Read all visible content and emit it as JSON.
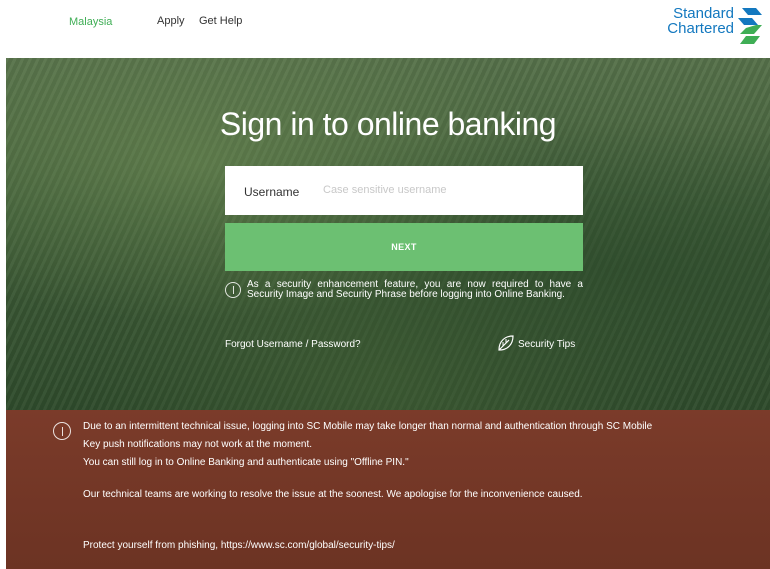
{
  "header": {
    "country": "Malaysia",
    "nav": {
      "apply": "Apply",
      "get_help": "Get Help"
    },
    "brand": {
      "line1": "Standard",
      "line2": "Chartered",
      "logo_icon": "sc-logo-icon"
    }
  },
  "login": {
    "title": "Sign in to online banking",
    "username_label": "Username",
    "username_placeholder": "Case sensitive username",
    "username_value": "",
    "next_label": "NEXT",
    "security_notice": "As a security enhancement feature, you are now required to have a Security Image and Security Phrase before logging into Online Banking.",
    "forgot_link": "Forgot Username / Password?",
    "security_tips": "Security Tips",
    "notice_icon": "info-icon",
    "tips_icon": "leaf-icon"
  },
  "alert": {
    "icon": "info-icon",
    "line1": "Due to an intermittent technical issue, logging into SC Mobile may take longer than normal and authentication through SC Mobile",
    "line2": "Key push notifications may not work at the moment.",
    "line3": "You can still log in to Online Banking and authenticate using \"Offline PIN.\"",
    "line4": "Our technical teams are working to resolve the issue at the soonest. We apologise for the inconvenience caused.",
    "line5": "Protect yourself from phishing, https://www.sc.com/global/security-tips/"
  },
  "colors": {
    "brand_blue": "#1378bf",
    "brand_green": "#3fae55",
    "next_button": "#6cc072",
    "alert_background": "#7b3b2a"
  }
}
